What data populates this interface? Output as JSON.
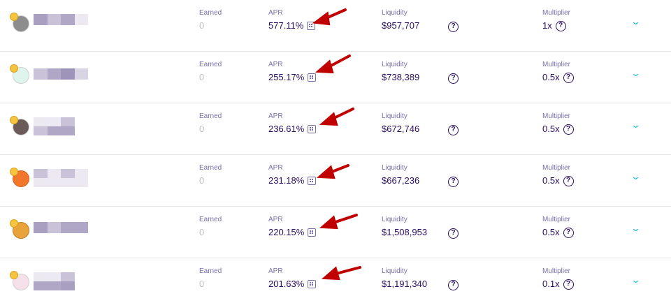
{
  "colors": {
    "label": "#7a6eaa",
    "value": "#280d5f",
    "muted": "#bdc2c4",
    "accent": "#1fc7d4",
    "annotation_arrow": "#c00000",
    "divider": "#e7e3eb"
  },
  "farms": [
    {
      "earned_label": "Earned",
      "earned_value": "0",
      "apr_label": "APR",
      "apr_value": "577.11%",
      "liquidity_label": "Liquidity",
      "liquidity_value": "$957,707",
      "multiplier_label": "Multiplier",
      "multiplier_value": "1x",
      "help_glyph": "?",
      "expand_glyph": "⌄"
    },
    {
      "earned_label": "Earned",
      "earned_value": "0",
      "apr_label": "APR",
      "apr_value": "255.17%",
      "liquidity_label": "Liquidity",
      "liquidity_value": "$738,389",
      "multiplier_label": "Multiplier",
      "multiplier_value": "0.5x",
      "help_glyph": "?",
      "expand_glyph": "⌄"
    },
    {
      "earned_label": "Earned",
      "earned_value": "0",
      "apr_label": "APR",
      "apr_value": "236.61%",
      "liquidity_label": "Liquidity",
      "liquidity_value": "$672,746",
      "multiplier_label": "Multiplier",
      "multiplier_value": "0.5x",
      "help_glyph": "?",
      "expand_glyph": "⌄"
    },
    {
      "earned_label": "Earned",
      "earned_value": "0",
      "apr_label": "APR",
      "apr_value": "231.18%",
      "liquidity_label": "Liquidity",
      "liquidity_value": "$667,236",
      "multiplier_label": "Multiplier",
      "multiplier_value": "0.5x",
      "help_glyph": "?",
      "expand_glyph": "⌄"
    },
    {
      "earned_label": "Earned",
      "earned_value": "0",
      "apr_label": "APR",
      "apr_value": "220.15%",
      "liquidity_label": "Liquidity",
      "liquidity_value": "$1,508,953",
      "multiplier_label": "Multiplier",
      "multiplier_value": "0.5x",
      "help_glyph": "?",
      "expand_glyph": "⌄"
    },
    {
      "earned_label": "Earned",
      "earned_value": "0",
      "apr_label": "APR",
      "apr_value": "201.63%",
      "liquidity_label": "Liquidity",
      "liquidity_value": "$1,191,340",
      "multiplier_label": "Multiplier",
      "multiplier_value": "0.1x",
      "help_glyph": "?",
      "expand_glyph": "⌄"
    }
  ]
}
